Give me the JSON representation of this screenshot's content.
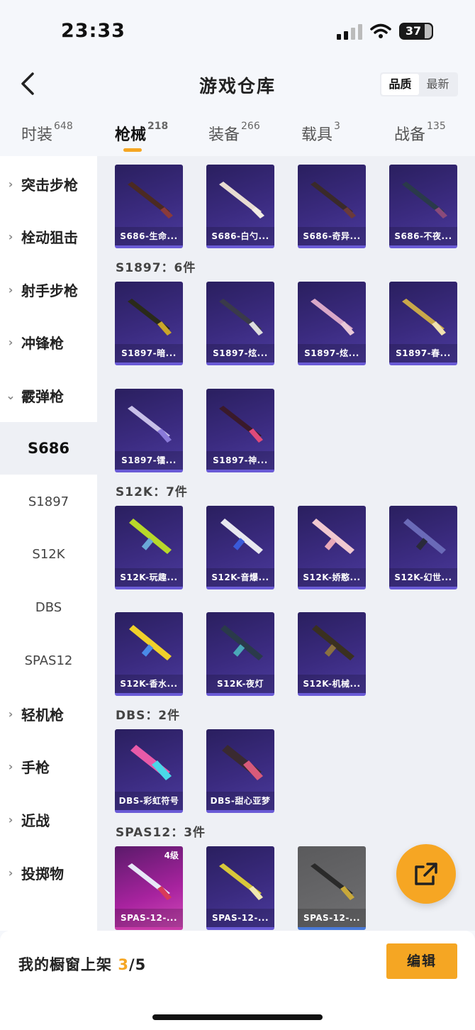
{
  "status": {
    "time": "23:33",
    "battery": "37"
  },
  "header": {
    "title": "游戏仓库",
    "sort_options": [
      "品质",
      "最新"
    ]
  },
  "tabs": [
    {
      "label": "时装",
      "count": "648"
    },
    {
      "label": "枪械",
      "count": "218"
    },
    {
      "label": "装备",
      "count": "266"
    },
    {
      "label": "载具",
      "count": "3"
    },
    {
      "label": "战备",
      "count": "135"
    }
  ],
  "sidebar": {
    "categories": [
      "突击步枪",
      "栓动狙击",
      "射手步枪",
      "冲锋枪",
      "霰弹枪"
    ],
    "subitems": [
      "S686",
      "S1897",
      "S12K",
      "DBS",
      "SPAS12"
    ],
    "categories_after": [
      "轻机枪",
      "手枪",
      "近战",
      "投掷物"
    ]
  },
  "sections": {
    "s686_items": [
      "S686-生命...",
      "S686-白勺...",
      "S686-奇异...",
      "S686-不夜..."
    ],
    "s1897_title": "S1897：6件",
    "s1897_items": [
      "S1897-暗...",
      "S1897-炫...",
      "S1897-炫...",
      "S1897-春...",
      "S1897-镭...",
      "S1897-神..."
    ],
    "s12k_title": "S12K：7件",
    "s12k_items": [
      "S12K-玩趣...",
      "S12K-音爆...",
      "S12K-娇憨...",
      "S12K-幻世...",
      "S12K-香水...",
      "S12K-夜灯",
      "S12K-机械..."
    ],
    "dbs_title": "DBS：2件",
    "dbs_items": [
      "DBS-彩虹符号",
      "DBS-甜心亚梦"
    ],
    "spas_title": "SPAS12：3件",
    "spas_items": [
      "SPAS-12-...",
      "SPAS-12-...",
      "SPAS-12-..."
    ],
    "spas_level": "4级"
  },
  "bottom": {
    "showcase_label": "我的橱窗上架",
    "current": "3",
    "total": "/5",
    "edit": "编辑"
  },
  "colors": {
    "accent": "#f5a623",
    "card_purple": "#3b2b80",
    "card_pink": "#a8239f"
  }
}
